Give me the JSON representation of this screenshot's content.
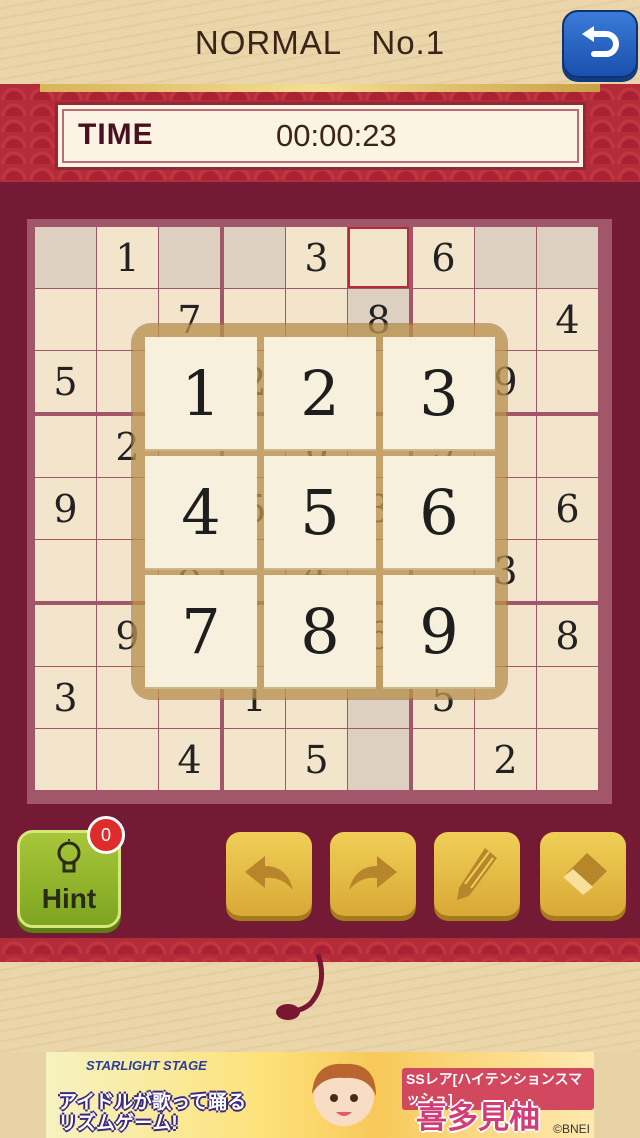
{
  "header": {
    "title": "NORMAL   No.1"
  },
  "timer": {
    "label": "TIME",
    "value": "00:00:23"
  },
  "board": {
    "rows": [
      [
        "",
        "1",
        "",
        "",
        "3",
        "",
        "6",
        "",
        ""
      ],
      [
        "",
        "",
        "7",
        "",
        "",
        "8",
        "",
        "",
        "4"
      ],
      [
        "5",
        "",
        "",
        "2",
        "",
        "",
        "",
        "9",
        ""
      ],
      [
        "",
        "2",
        "",
        "",
        "6",
        "",
        "9",
        "",
        ""
      ],
      [
        "9",
        "",
        "",
        "5",
        "",
        "3",
        "",
        "",
        "6"
      ],
      [
        "",
        "",
        "8",
        "",
        "4",
        "",
        "",
        "3",
        ""
      ],
      [
        "",
        "9",
        "",
        "",
        "",
        "6",
        "",
        "",
        "8"
      ],
      [
        "3",
        "",
        "",
        "1",
        "",
        "",
        "5",
        "",
        ""
      ],
      [
        "",
        "",
        "4",
        "",
        "5",
        "",
        "",
        "2",
        ""
      ]
    ],
    "selected_cell": "row 1, column 6"
  },
  "numpad": {
    "keys": [
      "1",
      "2",
      "3",
      "4",
      "5",
      "6",
      "7",
      "8",
      "9"
    ]
  },
  "controls": {
    "hint_label": "Hint",
    "hint_count": "0",
    "undo_icon": "undo-arrow-icon",
    "redo_icon": "redo-arrow-icon",
    "pencil_icon": "pencil-icon",
    "eraser_icon": "eraser-icon"
  },
  "ad": {
    "logo": "STARLIGHT STAGE",
    "copy_line1": "アイドルが歌って踊る",
    "copy_line2": "リズムゲーム!",
    "tag": "SSレア[ハイテンションスマッシュ]",
    "name": "喜多見柚",
    "credit": "©BNEI"
  },
  "colors": {
    "board_frame": "#741a35",
    "accent_red": "#b42c3a",
    "button_gold": "#e6bd45",
    "hint_green": "#8fb52b",
    "back_blue": "#2a63c4"
  }
}
